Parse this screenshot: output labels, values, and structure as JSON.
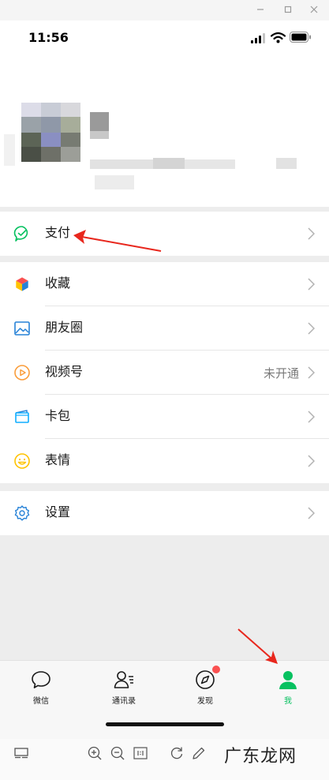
{
  "window": {
    "min_icon": "minimize-icon",
    "max_icon": "maximize-icon",
    "close_icon": "close-icon"
  },
  "status_bar": {
    "time": "11:56"
  },
  "menu": {
    "pay": {
      "label": "支付",
      "icon": "wechat-pay-icon"
    },
    "favorites": {
      "label": "收藏",
      "icon": "favorites-cube-icon"
    },
    "moments": {
      "label": "朋友圈",
      "icon": "moments-picture-icon"
    },
    "channels": {
      "label": "视频号",
      "value": "未开通",
      "icon": "channels-play-icon"
    },
    "cards": {
      "label": "卡包",
      "icon": "card-wallet-icon"
    },
    "stickers": {
      "label": "表情",
      "icon": "smiley-icon"
    },
    "settings": {
      "label": "设置",
      "icon": "gear-icon"
    }
  },
  "tabbar": {
    "chats": "微信",
    "contacts": "通讯录",
    "discover": "发现",
    "me": "我",
    "active_color": "#07c160"
  },
  "watermark": "广东龙网",
  "colors": {
    "accent_green": "#07c160",
    "arrow_red": "#e8271d",
    "badge_red": "#fa5151"
  }
}
